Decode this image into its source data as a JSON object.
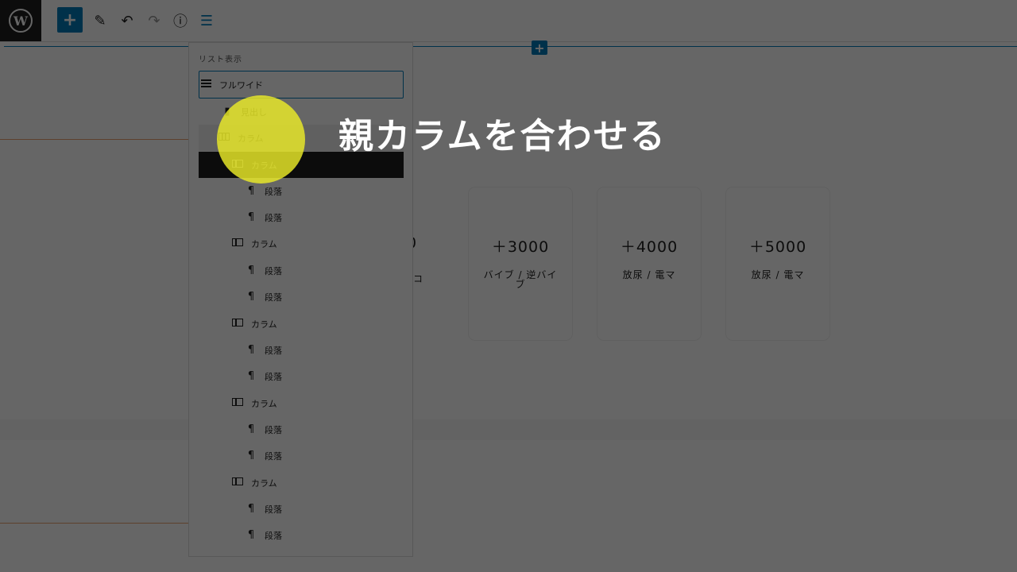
{
  "toolbar": {
    "logo": "W",
    "add_icon": "+",
    "tools_icon": "✎",
    "undo_icon": "↶",
    "redo_icon": "↷",
    "info_icon": "ⓘ",
    "list_view_icon": "☰"
  },
  "canvas": {
    "inserter": "+",
    "partial_card": {
      "amount": "0",
      "desc": "コ"
    },
    "cards": [
      {
        "amount": "＋3000",
        "desc": "バイブ / 逆バイブ"
      },
      {
        "amount": "＋4000",
        "desc": "放尿 / 電マ"
      },
      {
        "amount": "＋5000",
        "desc": "放尿 / 電マ"
      }
    ]
  },
  "list_view": {
    "title": "リスト表示",
    "items": [
      {
        "label": "フルワイド",
        "icon": "full-width-icon",
        "level": 0,
        "state": "focused"
      },
      {
        "label": "見出し",
        "icon": "bookmark-icon",
        "level": 1,
        "state": ""
      },
      {
        "label": "カラム",
        "icon": "columns-icon",
        "level": 1,
        "state": "parent"
      },
      {
        "label": "カラム",
        "icon": "column-icon",
        "level": 2,
        "state": "selected"
      },
      {
        "label": "段落",
        "icon": "paragraph-icon",
        "level": 3,
        "state": ""
      },
      {
        "label": "段落",
        "icon": "paragraph-icon",
        "level": 3,
        "state": ""
      },
      {
        "label": "カラム",
        "icon": "column-icon",
        "level": 2,
        "state": ""
      },
      {
        "label": "段落",
        "icon": "paragraph-icon",
        "level": 3,
        "state": ""
      },
      {
        "label": "段落",
        "icon": "paragraph-icon",
        "level": 3,
        "state": ""
      },
      {
        "label": "カラム",
        "icon": "column-icon",
        "level": 2,
        "state": ""
      },
      {
        "label": "段落",
        "icon": "paragraph-icon",
        "level": 3,
        "state": ""
      },
      {
        "label": "段落",
        "icon": "paragraph-icon",
        "level": 3,
        "state": ""
      },
      {
        "label": "カラム",
        "icon": "column-icon",
        "level": 2,
        "state": ""
      },
      {
        "label": "段落",
        "icon": "paragraph-icon",
        "level": 3,
        "state": ""
      },
      {
        "label": "段落",
        "icon": "paragraph-icon",
        "level": 3,
        "state": ""
      },
      {
        "label": "カラム",
        "icon": "column-icon",
        "level": 2,
        "state": ""
      },
      {
        "label": "段落",
        "icon": "paragraph-icon",
        "level": 3,
        "state": ""
      },
      {
        "label": "段落",
        "icon": "paragraph-icon",
        "level": 3,
        "state": ""
      }
    ]
  },
  "overlay": {
    "caption": "親カラムを合わせる"
  },
  "colors": {
    "accent": "#007cba",
    "dark": "#1e1e1e",
    "highlight": "#ebeb28"
  }
}
